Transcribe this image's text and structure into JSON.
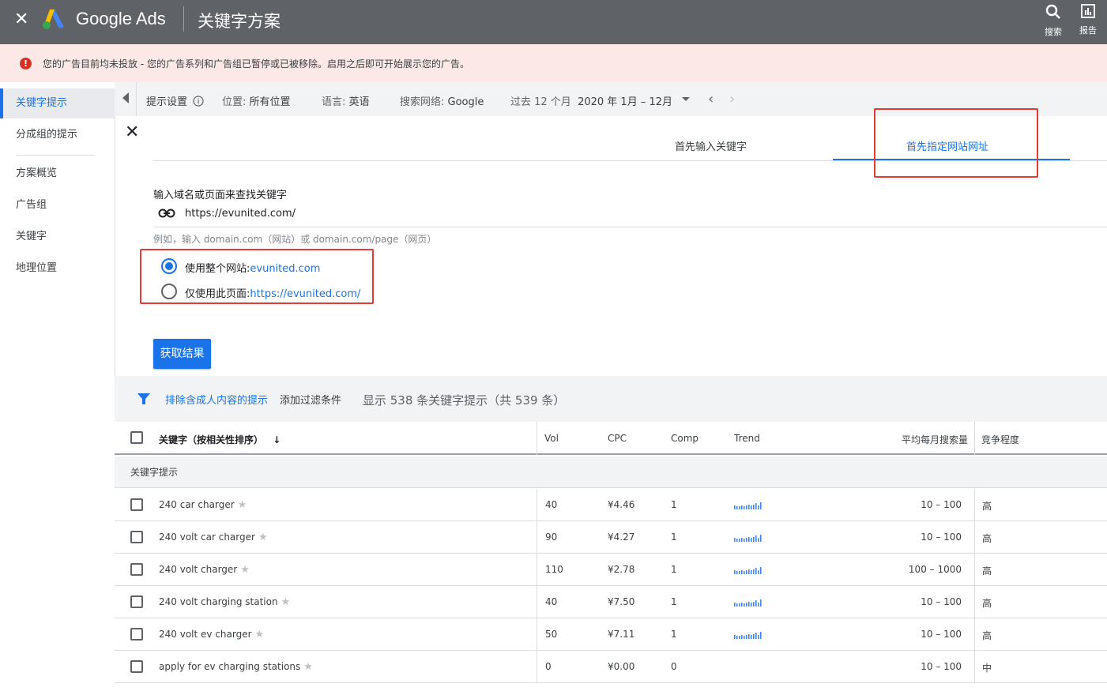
{
  "topbar": {
    "close": "✕",
    "brand": "Google Ads",
    "title": "关键字方案",
    "search_label": "搜索",
    "report_label": "报告"
  },
  "alert": {
    "icon": "!",
    "text": "您的广告目前均未投放 - 您的广告系列和广告组已暂停或已被移除。启用之后即可开始展示您的广告。"
  },
  "sidebar": {
    "items": [
      {
        "label": "关键字提示",
        "active": true
      },
      {
        "label": "分成组的提示",
        "active": false
      },
      {
        "label": "方案概览",
        "active": false
      },
      {
        "label": "广告组",
        "active": false
      },
      {
        "label": "关键字",
        "active": false
      },
      {
        "label": "地理位置",
        "active": false
      }
    ]
  },
  "filterbar": {
    "settings_label": "提示设置",
    "location_label": "位置:",
    "location_value": "所有位置",
    "language_label": "语言:",
    "language_value": "英语",
    "network_label": "搜索网络:",
    "network_value": "Google",
    "period_label": "过去 12 个月",
    "period_value": "2020 年 1月 – 12月"
  },
  "card": {
    "tabs": [
      "首先输入关键字",
      "首先指定网站网址"
    ],
    "active_tab": 1,
    "input_label": "输入域名或页面来查找关键字",
    "url_value": "https://evunited.com/",
    "hint": "例如，输入 domain.com（网站）或 domain.com/page（网页）",
    "radio_site_label": "使用整个网站:",
    "radio_site_value": "evunited.com",
    "radio_page_label": "仅使用此页面:",
    "radio_page_value": "https://evunited.com/",
    "selected_radio": "site",
    "submit_label": "获取结果"
  },
  "toolbar": {
    "filter_chip": "排除含成人内容的提示",
    "add_filter": "添加过滤条件",
    "summary": "显示 538 条关键字提示（共 539 条）"
  },
  "table": {
    "headers": {
      "keyword": "关键字（按相关性排序）",
      "vol": "Vol",
      "cpc": "CPC",
      "comp": "Comp",
      "trend": "Trend",
      "avg": "平均每月搜索量",
      "competition": "竞争程度"
    },
    "group_label": "关键字提示",
    "rows": [
      {
        "keyword": "240 car charger",
        "vol": "40",
        "cpc": "¥4.46",
        "comp": "1",
        "trend": true,
        "avg": "10 – 100",
        "competition": "高"
      },
      {
        "keyword": "240 volt car charger",
        "vol": "90",
        "cpc": "¥4.27",
        "comp": "1",
        "trend": true,
        "avg": "10 – 100",
        "competition": "高"
      },
      {
        "keyword": "240 volt charger",
        "vol": "110",
        "cpc": "¥2.78",
        "comp": "1",
        "trend": true,
        "avg": "100 – 1000",
        "competition": "高"
      },
      {
        "keyword": "240 volt charging station",
        "vol": "40",
        "cpc": "¥7.50",
        "comp": "1",
        "trend": true,
        "avg": "10 – 100",
        "competition": "高"
      },
      {
        "keyword": "240 volt ev charger",
        "vol": "50",
        "cpc": "¥7.11",
        "comp": "1",
        "trend": true,
        "avg": "10 – 100",
        "competition": "高"
      },
      {
        "keyword": "apply for ev charging stations",
        "vol": "0",
        "cpc": "¥0.00",
        "comp": "0",
        "trend": false,
        "avg": "10 – 100",
        "competition": "中"
      }
    ]
  },
  "colors": {
    "accent": "#1a73e8",
    "topbar": "#5f6368",
    "alert_bg": "#fce8e6",
    "error": "#d93025",
    "annotation_box": "#e53935"
  }
}
